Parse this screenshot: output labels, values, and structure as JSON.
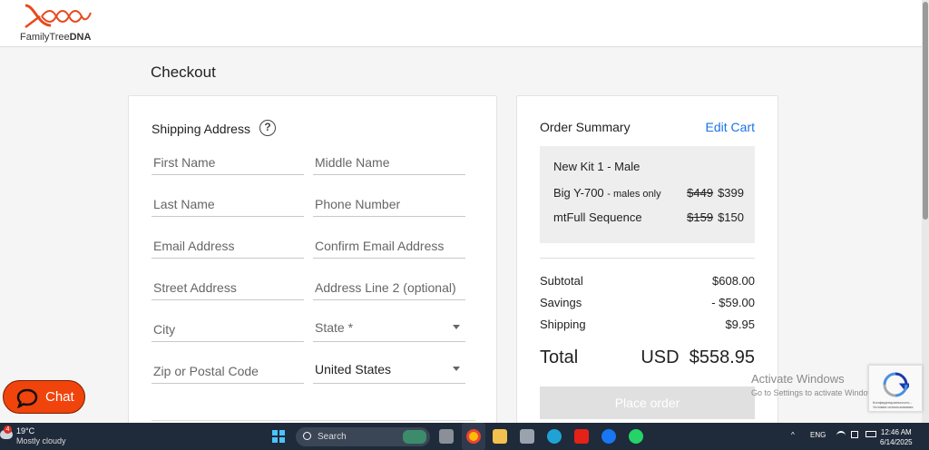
{
  "header": {
    "logo_text_regular": "FamilyTree",
    "logo_text_bold": "DNA"
  },
  "page": {
    "title": "Checkout"
  },
  "shipping": {
    "title": "Shipping Address",
    "help_symbol": "?",
    "fields": {
      "first_name": "First Name",
      "middle_name": "Middle Name",
      "last_name": "Last Name",
      "phone": "Phone Number",
      "email": "Email Address",
      "confirm_email": "Confirm Email Address",
      "street": "Street Address",
      "address2": "Address Line 2 (optional)",
      "city": "City",
      "state": "State *",
      "zip": "Zip or Postal Code",
      "country_value": "United States"
    }
  },
  "summary": {
    "title": "Order Summary",
    "edit_cart": "Edit Cart",
    "items": [
      {
        "name": "New Kit 1 - Male",
        "note": "",
        "old_price": "",
        "price": ""
      },
      {
        "name": "Big Y-700",
        "note": "- males only",
        "old_price": "$449",
        "price": "$399"
      },
      {
        "name": "mtFull Sequence",
        "note": "",
        "old_price": "$159",
        "price": "$150"
      }
    ],
    "subtotal_label": "Subtotal",
    "subtotal": "$608.00",
    "savings_label": "Savings",
    "savings": "- $59.00",
    "shipping_label": "Shipping",
    "shipping": "$9.95",
    "total_label": "Total",
    "total": "USD  $558.95",
    "place_order": "Place order"
  },
  "chat": {
    "label": "Chat"
  },
  "watermark": {
    "title": "Activate Windows",
    "subtitle": "Go to Settings to activate Windows."
  },
  "recaptcha": {
    "text": "Конфиденциальность - Условия использования"
  },
  "taskbar": {
    "weather_temp": "19°C",
    "weather_desc": "Mostly cloudy",
    "weather_badge": "4",
    "search": "Search",
    "lang": "ENG",
    "time": "12:46 AM",
    "date": "6/14/2025"
  },
  "colors": {
    "accent_link": "#1a73e8",
    "chat": "#f0440c",
    "logo": "#e8491d"
  },
  "icons": [
    "logo-helix-icon",
    "help-icon",
    "chevron-down-icon",
    "chat-bubble-icon",
    "recaptcha-icon",
    "windows-start-icon",
    "search-icon"
  ]
}
